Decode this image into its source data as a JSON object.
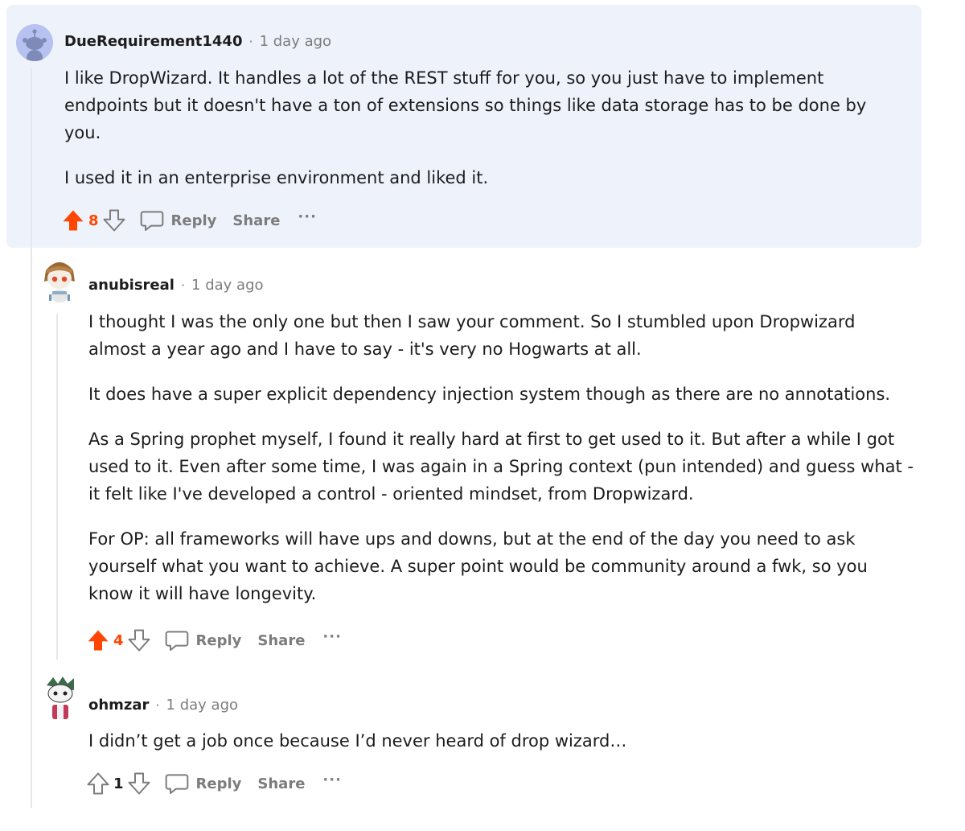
{
  "colors": {
    "upvote_active": "#ff4500",
    "muted": "#7c7c7c",
    "text": "#1c1c1c",
    "highlight_bg": "#eef2fb"
  },
  "comments": [
    {
      "author": "DueRequirement1440",
      "separator": "·",
      "time": "1 day ago",
      "paragraphs": [
        "I like DropWizard. It handles a lot of the REST stuff for you, so you just have to implement endpoints but it doesn't have a ton of extensions so things like data storage has to be done by you.",
        "I used it in an enterprise environment and liked it."
      ],
      "score": "8",
      "upvoted": true,
      "reply_label": "Reply",
      "share_label": "Share",
      "more_label": "···"
    },
    {
      "author": "anubisreal",
      "separator": "·",
      "time": "1 day ago",
      "paragraphs": [
        "I thought I was the only one but then I saw your comment. So I stumbled upon Dropwizard almost a year ago and I have to say - it's very no Hogwarts at all.",
        "It does have a super explicit dependency injection system though as there are no annotations.",
        "As a Spring prophet myself, I found it really hard at first to get used to it. But after a while I got used to it. Even after some time, I was again in a Spring context (pun intended) and guess what - it felt like I've developed a control - oriented mindset, from Dropwizard.",
        "For OP: all frameworks will have ups and downs, but at the end of the day you need to ask yourself what you want to achieve. A super point would be community around a fwk, so you know it will have longevity."
      ],
      "score": "4",
      "upvoted": true,
      "reply_label": "Reply",
      "share_label": "Share",
      "more_label": "···"
    },
    {
      "author": "ohmzar",
      "separator": "·",
      "time": "1 day ago",
      "paragraphs": [
        "I didn’t get a job once because I’d never heard of drop wizard…"
      ],
      "score": "1",
      "upvoted": false,
      "reply_label": "Reply",
      "share_label": "Share",
      "more_label": "···"
    }
  ]
}
